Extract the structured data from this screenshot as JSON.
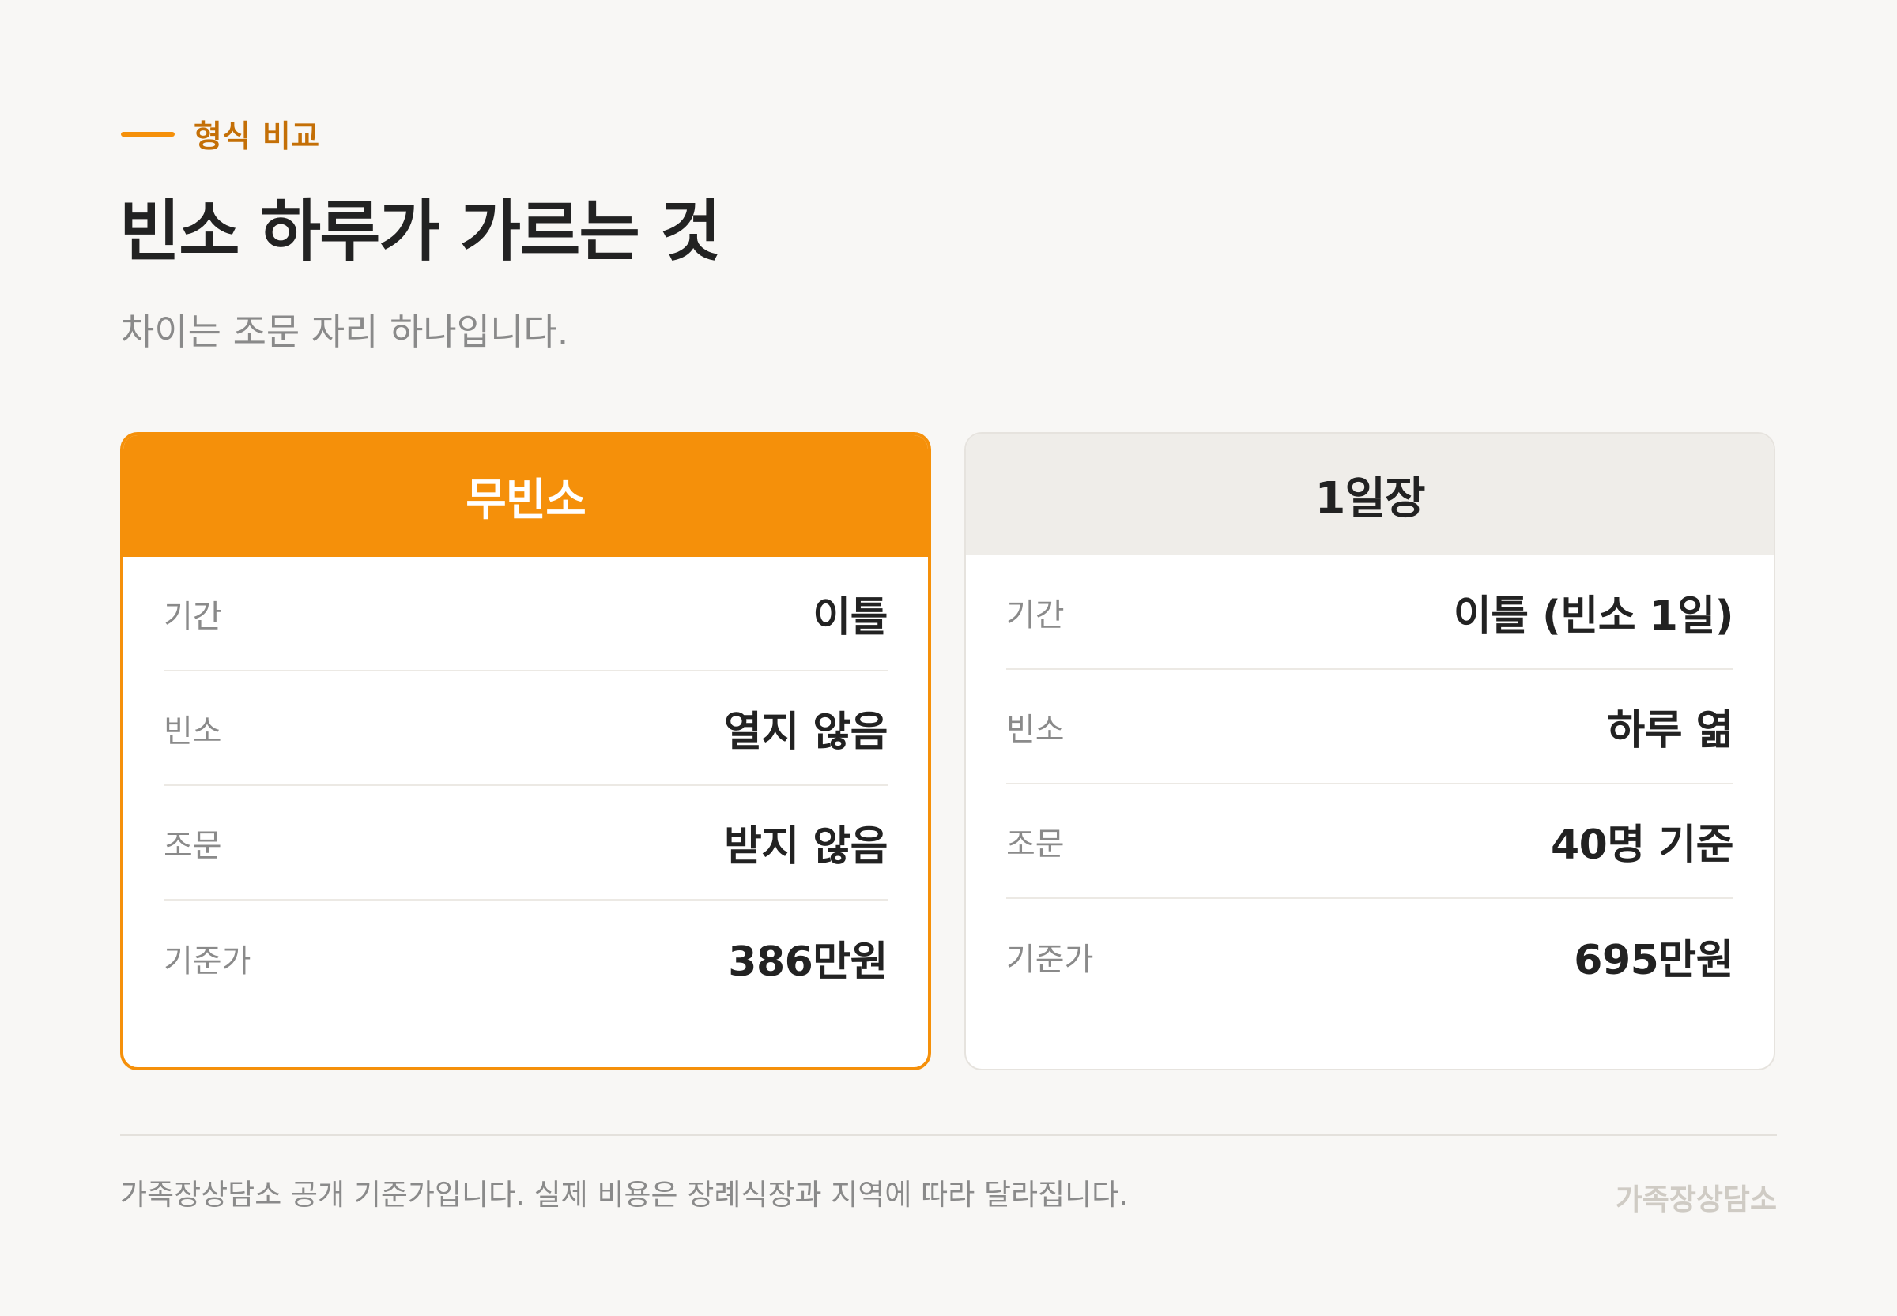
{
  "header": {
    "eyebrow": "형식 비교",
    "title": "빈소 하루가 가르는 것",
    "subtitle": "차이는 조문 자리 하나입니다."
  },
  "cards": [
    {
      "title": "무빈소",
      "highlighted": true,
      "rows": [
        {
          "label": "기간",
          "value": "이틀"
        },
        {
          "label": "빈소",
          "value": "열지 않음"
        },
        {
          "label": "조문",
          "value": "받지 않음"
        },
        {
          "label": "기준가",
          "value": "386만원"
        }
      ]
    },
    {
      "title": "1일장",
      "highlighted": false,
      "rows": [
        {
          "label": "기간",
          "value": "이틀 (빈소 1일)"
        },
        {
          "label": "빈소",
          "value": "하루 엶"
        },
        {
          "label": "조문",
          "value": "40명 기준"
        },
        {
          "label": "기준가",
          "value": "695만원"
        }
      ]
    }
  ],
  "footer": {
    "note": "가족장상담소 공개 기준가입니다. 실제 비용은 장례식장과 지역에 따라 달라집니다.",
    "brand": "가족장상담소"
  },
  "colors": {
    "accent": "#f5900a",
    "accent_text": "#c46f06",
    "background": "#f8f7f5",
    "text": "#222222",
    "muted": "#8a8a8a"
  }
}
